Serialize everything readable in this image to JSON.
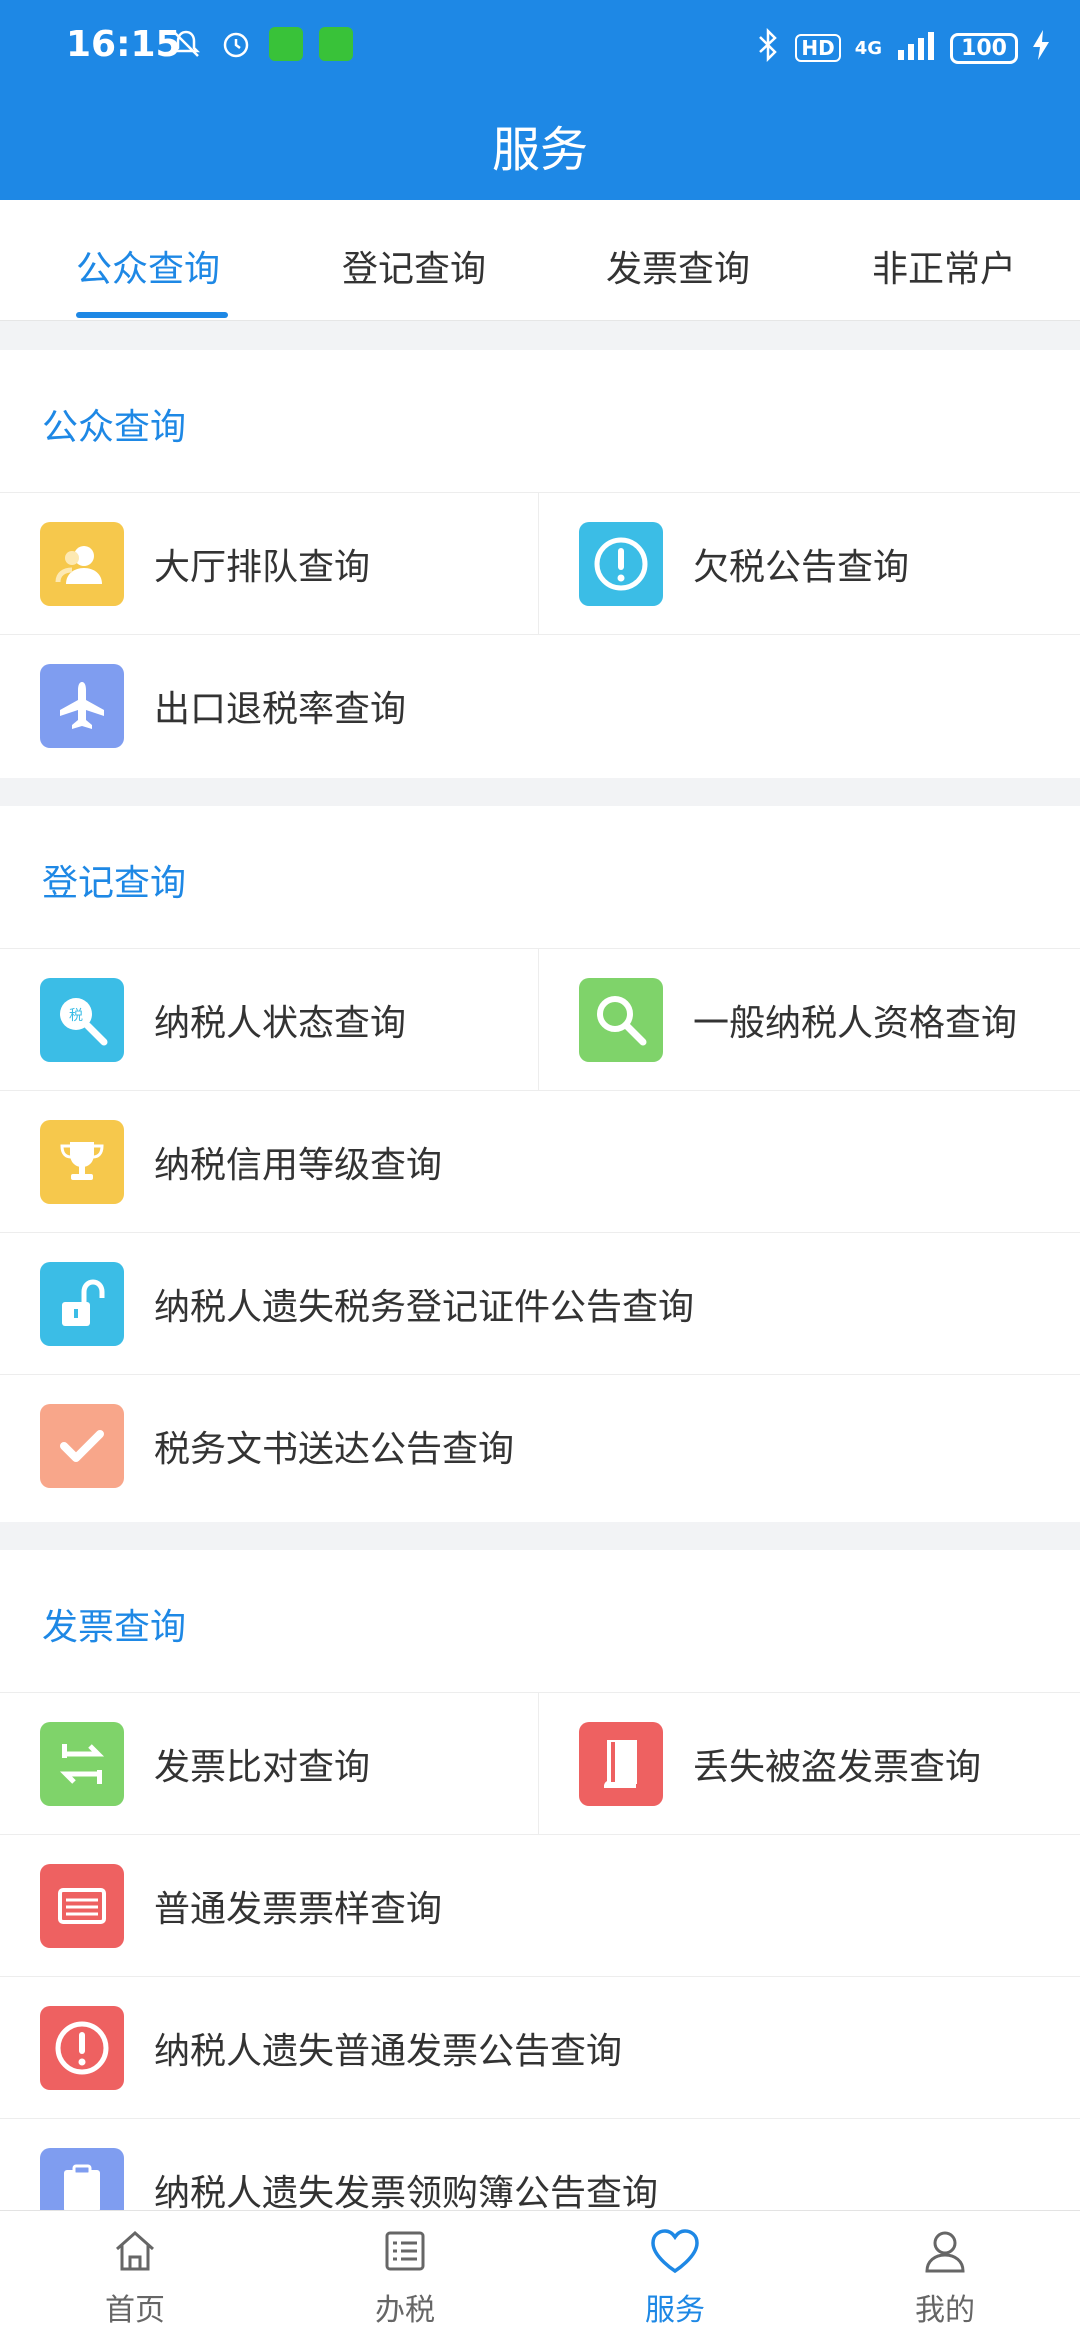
{
  "status_bar": {
    "time": "16:15",
    "hd": "HD",
    "network": "4G",
    "battery": "100"
  },
  "header": {
    "title": "服务"
  },
  "tabs": [
    {
      "label": "公众查询"
    },
    {
      "label": "登记查询"
    },
    {
      "label": "发票查询"
    },
    {
      "label": "非正常户"
    }
  ],
  "sections": {
    "public": {
      "title": "公众查询",
      "items": [
        {
          "label": "大厅排队查询",
          "icon": "users-icon",
          "color": "#f6c84c"
        },
        {
          "label": "欠税公告查询",
          "icon": "alert-icon",
          "color": "#3bbde6"
        },
        {
          "label": "出口退税率查询",
          "icon": "airplane-icon",
          "color": "#7f9df0"
        }
      ]
    },
    "registration": {
      "title": "登记查询",
      "items": [
        {
          "label": "纳税人状态查询",
          "icon": "tax-search-icon",
          "color": "#3bbde6"
        },
        {
          "label": "一般纳税人资格查询",
          "icon": "search-icon",
          "color": "#7fd36a"
        },
        {
          "label": "纳税信用等级查询",
          "icon": "trophy-icon",
          "color": "#f6c84c"
        },
        {
          "label": "纳税人遗失税务登记证件公告查询",
          "icon": "unlock-icon",
          "color": "#3bbde6"
        },
        {
          "label": "税务文书送达公告查询",
          "icon": "check-icon",
          "color": "#f8a68a"
        }
      ]
    },
    "invoice": {
      "title": "发票查询",
      "items": [
        {
          "label": "发票比对查询",
          "icon": "compare-icon",
          "color": "#7fd36a"
        },
        {
          "label": "丢失被盗发票查询",
          "icon": "book-icon",
          "color": "#ee6161"
        },
        {
          "label": "普通发票票样查询",
          "icon": "invoice-icon",
          "color": "#ee6161"
        },
        {
          "label": "纳税人遗失普通发票公告查询",
          "icon": "alert-icon",
          "color": "#ee6161"
        },
        {
          "label": "纳税人遗失发票领购簿公告查询",
          "icon": "clipboard-icon",
          "color": "#7f9df0"
        }
      ]
    }
  },
  "bottom_nav": [
    {
      "label": "首页",
      "icon": "home-icon"
    },
    {
      "label": "办税",
      "icon": "list-icon"
    },
    {
      "label": "服务",
      "icon": "heart-icon"
    },
    {
      "label": "我的",
      "icon": "user-icon"
    }
  ],
  "colors": {
    "accent": "#1e88e5"
  }
}
